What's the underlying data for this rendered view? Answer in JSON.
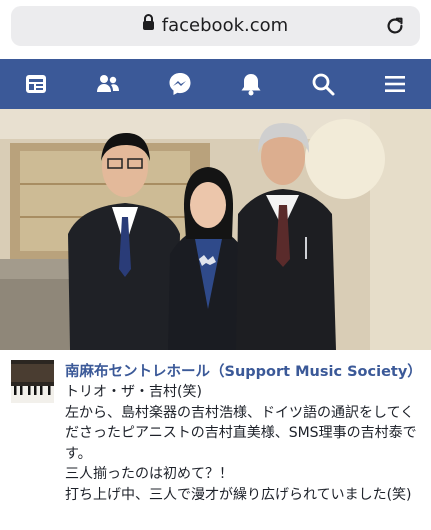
{
  "browser": {
    "url": "facebook.com",
    "lock_icon": "lock-icon",
    "reload_icon": "reload-icon"
  },
  "nav": {
    "color": "#3b5998",
    "items": [
      {
        "name": "news-feed-icon"
      },
      {
        "name": "friends-icon"
      },
      {
        "name": "messenger-icon"
      },
      {
        "name": "notifications-bell-icon"
      },
      {
        "name": "search-icon"
      },
      {
        "name": "menu-icon"
      }
    ]
  },
  "post": {
    "page_name": "南麻布セントレホール（Support Music Society）",
    "lines": [
      "トリオ・ザ・吉村(笑)",
      "左から、島村楽器の吉村浩様、ドイツ語の通訳をしてくださったピアニストの吉村直美様、SMS理事の吉村泰です。",
      "三人揃ったのは初めて？！",
      "打ち上げ中、三人で漫才が繰り広げられていました(笑)"
    ]
  }
}
